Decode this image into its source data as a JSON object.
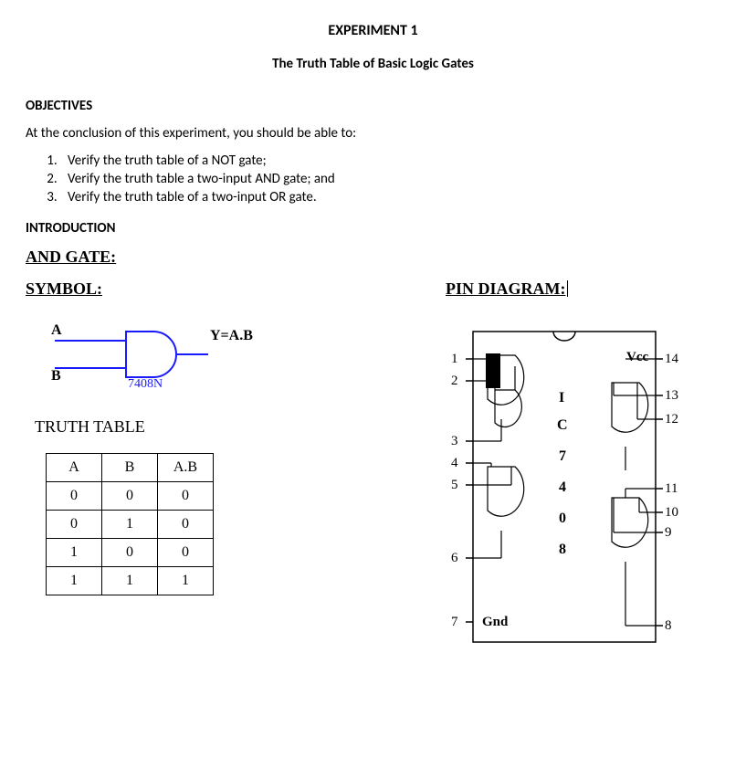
{
  "title": "EXPERIMENT 1",
  "subtitle": "The Truth Table of Basic Logic Gates",
  "objectives_heading": "OBJECTIVES",
  "objectives_intro": "At the conclusion of this experiment, you should be able to:",
  "objectives": [
    "Verify the truth table of a NOT gate;",
    "Verify the truth table a two-input AND gate; and",
    "Verify the truth table of a two-input  OR gate."
  ],
  "introduction_heading": "INTRODUCTION",
  "gate_heading": "AND GATE:",
  "symbol_heading": "SYMBOL:",
  "pin_heading": "PIN DIAGRAM:",
  "symbol": {
    "input_a": "A",
    "input_b": "B",
    "chip": "7408N",
    "output": "Y=A.B"
  },
  "truth_heading": "TRUTH TABLE",
  "truth": {
    "headers": [
      "A",
      "B",
      "A.B"
    ],
    "rows": [
      [
        "0",
        "0",
        "0"
      ],
      [
        "0",
        "1",
        "0"
      ],
      [
        "1",
        "0",
        "0"
      ],
      [
        "1",
        "1",
        "1"
      ]
    ]
  },
  "pin": {
    "left_labels": [
      "1",
      "2",
      "3",
      "4",
      "5",
      "6",
      "7"
    ],
    "right_labels": [
      "14",
      "13",
      "12",
      "11",
      "10",
      "9",
      "8"
    ],
    "vcc": "Vcc",
    "gnd": "Gnd",
    "center_label": [
      "I",
      "C",
      "7",
      "4",
      "0",
      "8"
    ]
  }
}
